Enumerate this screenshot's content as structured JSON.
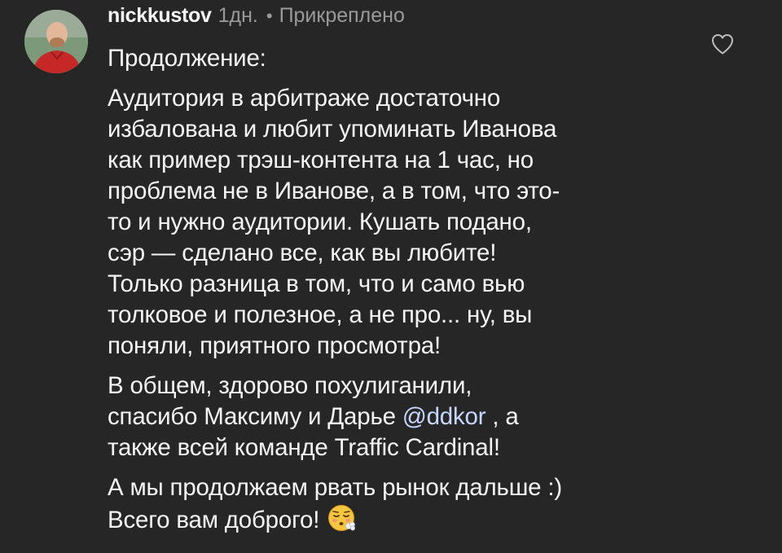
{
  "comment": {
    "username": "nickkustov",
    "time": "1дн.",
    "separator": "•",
    "pinned_label": "Прикреплено",
    "paragraphs": [
      {
        "lines": [
          "Продолжение:"
        ]
      },
      {
        "lines": [
          "Аудитория в арбитраже достаточно",
          "избалована и любит упоминать Иванова",
          "как пример трэш-контента на 1 час, но",
          "проблема не в Иванове, а в том, что это-",
          "то и нужно аудитории. Кушать подано,",
          "сэр — сделано все, как вы любите!",
          "Только разница в том, что и само вью",
          "толковое и полезное, а не про... ну, вы",
          "поняли, приятного просмотра!"
        ]
      },
      {
        "line1": "В общем, здорово похулиганили,",
        "line2_before": "спасибо Максиму и Дарье ",
        "mention": "@ddkor",
        "line2_after": " , а",
        "line3": "также всей команде Traffic Cardinal!"
      },
      {
        "line1": "А мы продолжаем рвать рынок дальше :)",
        "line2": "Всего вам доброго!",
        "emoji": "face-exhaling-emoji"
      }
    ],
    "like_icon": "heart-outline-icon",
    "avatar_icon": "user-avatar-photo"
  },
  "colors": {
    "background": "#262626",
    "text": "#f5f5f5",
    "meta": "#9a9a9a",
    "mention": "#c7d6ff"
  }
}
